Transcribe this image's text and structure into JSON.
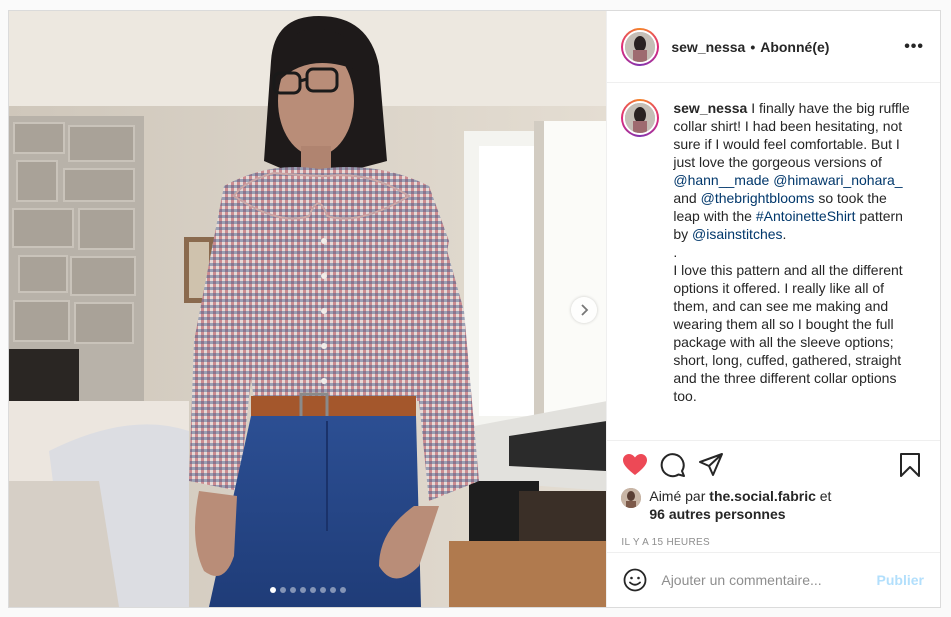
{
  "header": {
    "username": "sew_nessa",
    "separator": "•",
    "follow_status": "Abonné(e)",
    "more_label": "•••"
  },
  "caption": {
    "username": "sew_nessa",
    "text_1": " I finally have the big ruffle collar shirt! I had been hesitating, not sure if I would feel comfortable. But I just love the gorgeous versions of ",
    "mention_1": "@hann__made",
    "mention_2": "@himawari_nohara_",
    "text_2": " and ",
    "mention_3": "@thebrightblooms",
    "text_3": " so took the leap with the ",
    "hashtag": "#AntoinetteShirt",
    "text_4": " pattern by ",
    "mention_4": "@isainstitches",
    "text_5": ".",
    "text_6": ".",
    "text_7": "I love this pattern and all the different options it offered. I really like all of them, and can see me making and wearing them all so I bought the full package with all the sleeve options; short, long, cuffed, gathered, straight and the three different collar options too."
  },
  "actions": {
    "like_icon": "heart-icon",
    "comment_icon": "comment-icon",
    "share_icon": "share-icon",
    "save_icon": "bookmark-icon",
    "like_color": "#ed4956"
  },
  "likes": {
    "prefix": "Aimé par ",
    "user": "the.social.fabric",
    "connector": " et",
    "others": "96 autres personnes"
  },
  "timestamp": "IL Y A 15 HEURES",
  "comment": {
    "placeholder": "Ajouter un commentaire...",
    "publish_label": "Publier",
    "emoji_icon": "emoji-icon"
  },
  "carousel": {
    "slide_count": 8,
    "active_index": 0,
    "next_icon": "chevron-right-icon"
  }
}
